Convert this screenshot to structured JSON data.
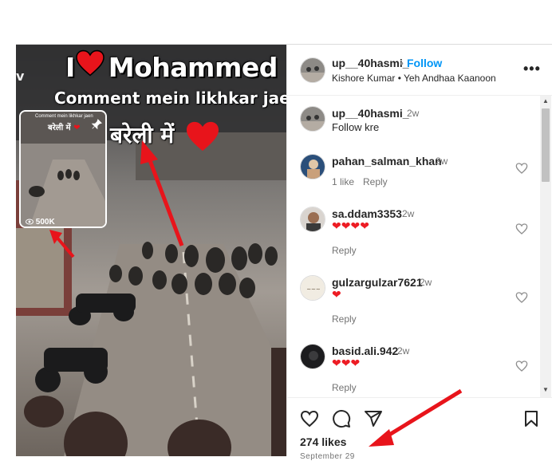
{
  "media": {
    "headline_prefix": "I",
    "headline_name": "Mohammed",
    "subline": "Comment mein likhkar jaen",
    "hindi_caption": "बरेली में",
    "side_letter": "v",
    "pip": {
      "caption": "Comment mein likhkar jaen",
      "hindi": "बरेली में",
      "views": "500K"
    }
  },
  "post": {
    "username": "up__40hasmi_",
    "dot": "•",
    "follow_label": "Follow",
    "audio": "Kishore Kumar • Yeh Andhaa Kaanoon",
    "more_label": "•••"
  },
  "comments": [
    {
      "username": "up__40hasmi_",
      "time": "2w",
      "text": "Follow kre"
    },
    {
      "username": "pahan_salman_khan",
      "time": "2w",
      "likes": "1 like",
      "reply": "Reply"
    },
    {
      "username": "sa.ddam3353",
      "time": "2w",
      "hearts": "❤❤❤❤",
      "reply": "Reply"
    },
    {
      "username": "gulzargulzar7621",
      "time": "2w",
      "hearts": "❤",
      "reply": "Reply"
    },
    {
      "username": "basid.ali.942",
      "time": "2w",
      "hearts": "❤❤❤",
      "reply": "Reply"
    }
  ],
  "footer": {
    "likes": "274 likes",
    "date": "September 29"
  },
  "colors": {
    "accent": "#0095f6",
    "heart": "#ed1c24",
    "annotation_arrow": "#e8141b"
  },
  "icons": [
    "heart-icon",
    "comment-icon",
    "share-icon",
    "bookmark-icon",
    "more-icon",
    "pin-icon",
    "eye-icon"
  ]
}
